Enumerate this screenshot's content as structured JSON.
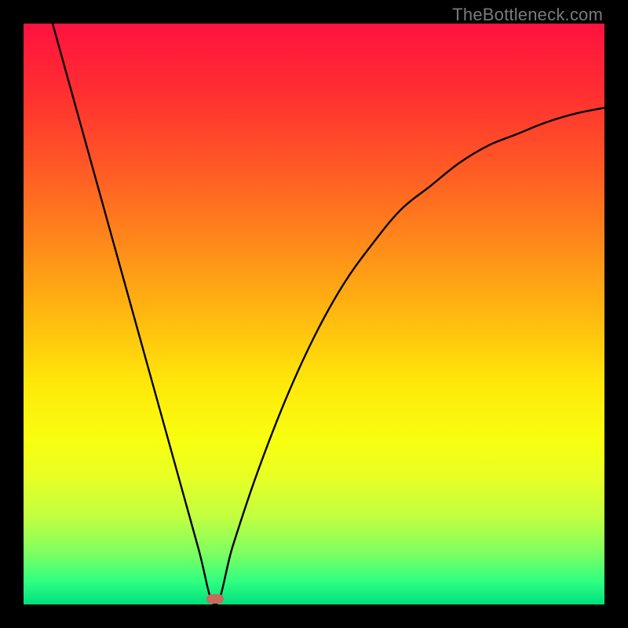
{
  "watermark": "TheBottleneck.com",
  "colors": {
    "frame": "#000000",
    "curve": "#000000",
    "marker": "#c96a5a",
    "gradient_stops": [
      "#ff1240",
      "#ff2f30",
      "#ff5a25",
      "#ff8a1a",
      "#ffb810",
      "#ffe80a",
      "#f8ff10",
      "#e8ff25",
      "#c0ff40",
      "#80ff60",
      "#30ff80",
      "#00e080"
    ]
  },
  "chart_data": {
    "type": "line",
    "title": "",
    "xlabel": "",
    "ylabel": "",
    "xlim": [
      0,
      100
    ],
    "ylim": [
      0,
      100
    ],
    "minimum_x": 33,
    "series": [
      {
        "name": "bottleneck-curve",
        "x": [
          5,
          10,
          15,
          20,
          25,
          30,
          33,
          36,
          40,
          45,
          50,
          55,
          60,
          65,
          70,
          75,
          80,
          85,
          90,
          95,
          100
        ],
        "y": [
          100,
          82,
          64,
          46,
          28,
          10,
          0,
          10,
          22,
          35,
          46,
          55,
          62,
          68,
          72,
          76,
          79,
          81,
          83,
          84.5,
          85.5
        ]
      }
    ],
    "annotations": [
      {
        "name": "optimal-point",
        "x": 33,
        "y": 1
      }
    ]
  }
}
